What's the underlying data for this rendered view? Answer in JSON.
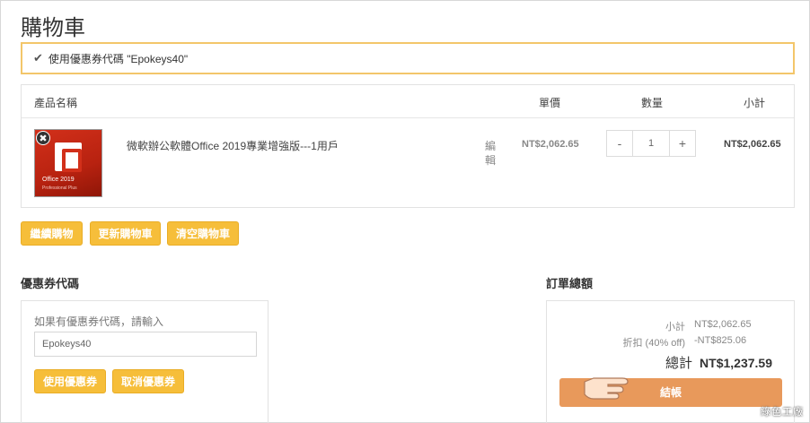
{
  "page": {
    "title": "購物車",
    "notice": "使用優惠券代碼 \"Epokeys40\""
  },
  "cart": {
    "headers": {
      "name": "產品名稱",
      "price": "單價",
      "qty": "數量",
      "subtotal": "小計"
    },
    "items": [
      {
        "thumb_title": "Office 2019",
        "thumb_sub": "Professional Plus",
        "name": "微軟辦公軟體Office 2019專業增強版---1用戶",
        "edit": "編輯",
        "price": "NT$2,062.65",
        "qty": "1",
        "minus": "-",
        "plus": "+",
        "subtotal": "NT$2,062.65",
        "remove": "✖"
      }
    ]
  },
  "actions": {
    "continue": "繼續購物",
    "update": "更新購物車",
    "clear": "清空購物車"
  },
  "coupon": {
    "title": "優惠券代碼",
    "hint": "如果有優惠券代碼，請輸入",
    "value": "Epokeys40",
    "apply": "使用優惠券",
    "cancel": "取消優惠券"
  },
  "totals": {
    "title": "訂單總額",
    "subtotal_label": "小計",
    "subtotal": "NT$2,062.65",
    "discount_label": "折扣 (40% off)",
    "discount": "-NT$825.06",
    "total_label": "總計",
    "total": "NT$1,237.59",
    "checkout": "結帳"
  },
  "watermark": "綠色工廠",
  "colors": {
    "accent": "#f6be3a",
    "checkout": "#e8995b",
    "notice_border": "#f3c66a"
  }
}
